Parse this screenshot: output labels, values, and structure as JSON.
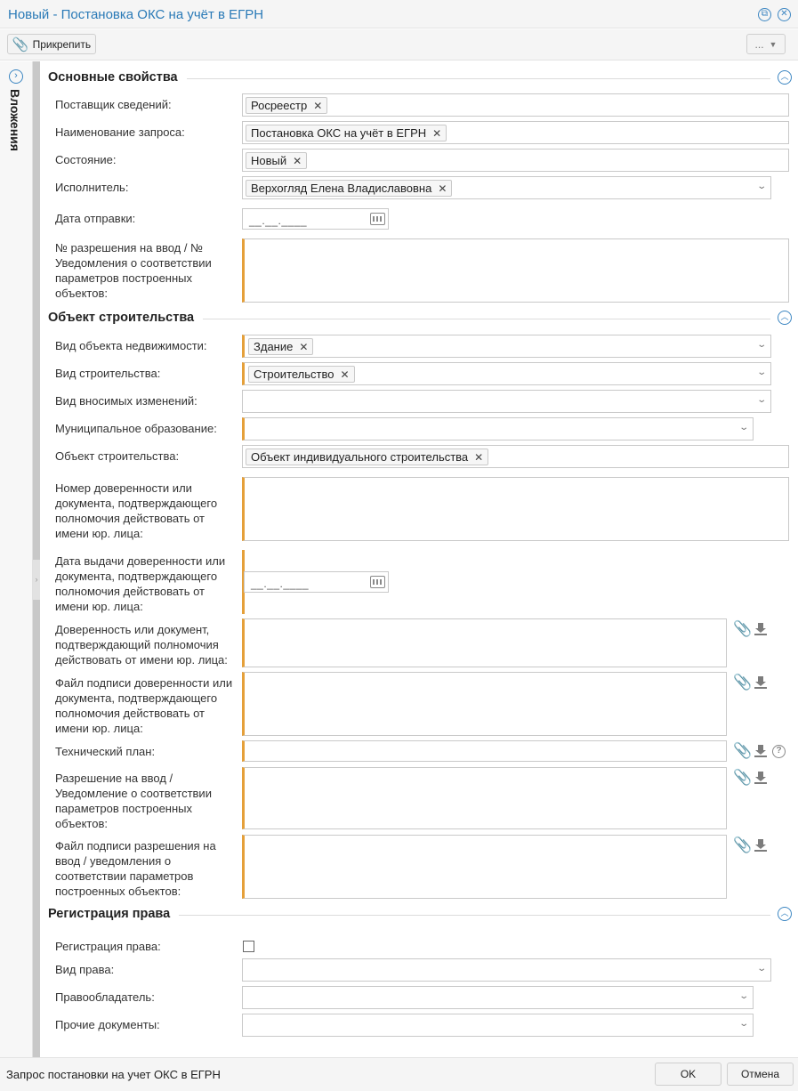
{
  "window": {
    "title": "Новый - Постановка ОКС на учёт в ЕГРН"
  },
  "toolbar": {
    "pin_label": "Прикрепить",
    "more_label": "..."
  },
  "sidebar": {
    "label": "Вложения"
  },
  "sections": {
    "basic": "Основные свойства",
    "object": "Объект строительства",
    "rights": "Регистрация права"
  },
  "basic": {
    "provider_label": "Поставщик сведений:",
    "provider_value": "Росреестр",
    "request_label": "Наименование запроса:",
    "request_value": "Постановка ОКС на учёт в ЕГРН",
    "state_label": "Состояние:",
    "state_value": "Новый",
    "executor_label": "Исполнитель:",
    "executor_value": "Верхогляд Елена Владиславовна",
    "send_date_label": "Дата отправки:",
    "date_mask": "__.__.____",
    "permit_label": "№ разрешения на ввод / № Уведомления о соответствии параметров построенных объектов:"
  },
  "object": {
    "property_type_label": "Вид объекта недвижимости:",
    "property_type_value": "Здание",
    "construction_type_label": "Вид строительства:",
    "construction_type_value": "Строительство",
    "changes_type_label": "Вид вносимых изменений:",
    "municipality_label": "Муниципальное образование:",
    "construction_object_label": "Объект строительства:",
    "construction_object_value": "Объект индивидуального строительства",
    "poa_number_label": "Номер доверенности или документа, подтверждающего полномочия действовать от имени юр. лица:",
    "poa_date_label": "Дата выдачи доверенности или документа, подтверждающего полномочия действовать от имени юр. лица:",
    "poa_doc_label": "Доверенность или документ, подтверждающий полномочия действовать от имени юр. лица:",
    "poa_sig_label": "Файл подписи доверенности или документа, подтверждающего полномочия действовать от имени юр. лица:",
    "tech_plan_label": "Технический план:",
    "permit_file_label": "Разрешение на ввод / Уведомление о соответствии параметров построенных объектов:",
    "permit_sig_label": "Файл подписи разрешения на ввод / уведомления о соответствии параметров построенных объектов:"
  },
  "rights": {
    "registration_label": "Регистрация права:",
    "registration_checked": false,
    "right_type_label": "Вид права:",
    "holder_label": "Правообладатель:",
    "other_docs_label": "Прочие документы:"
  },
  "footer": {
    "status": "Запрос постановки на учет ОКС в ЕГРН",
    "ok_label": "OK",
    "cancel_label": "Отмена"
  },
  "icons": {
    "window": [
      "restore-icon",
      "close-icon"
    ],
    "sidebar": "expand-icon",
    "section": "collapse-icon",
    "file": [
      "paperclip-icon",
      "download-icon",
      "help-icon"
    ]
  },
  "colors": {
    "accent": "#2a7ab7",
    "required": "#e5a03a"
  }
}
